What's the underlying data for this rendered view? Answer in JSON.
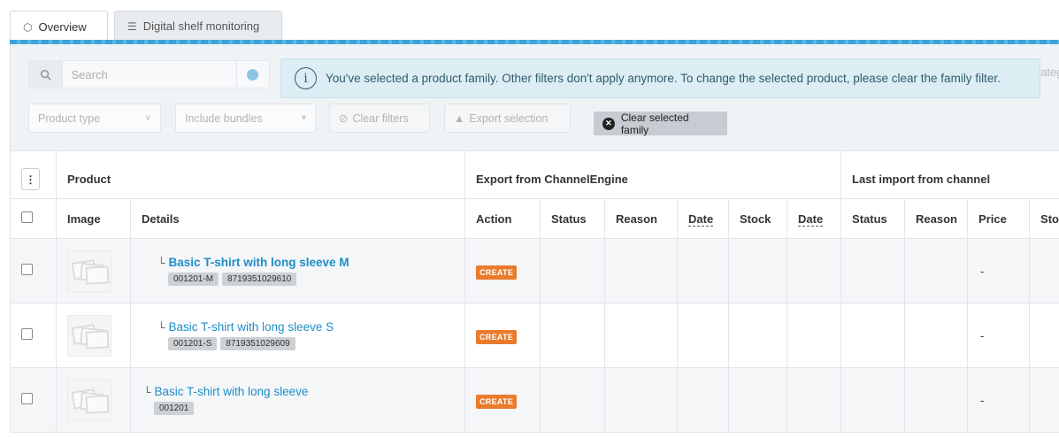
{
  "tabs": [
    {
      "label": "Overview",
      "icon": "tag-icon",
      "active": true
    },
    {
      "label": "Digital shelf monitoring",
      "icon": "list-icon",
      "active": false
    }
  ],
  "filters": {
    "search_placeholder": "Search",
    "alert_text": "You've selected a product family. Other filters don't apply anymore. To change the selected product, please clear the family filter.",
    "alert_tail": "ateg",
    "product_type": "Product type",
    "bundles": "Include bundles",
    "clear_filters": "Clear filters",
    "export_selection": "Export selection",
    "clear_family": "Clear selected family"
  },
  "table": {
    "group_headers": {
      "product": "Product",
      "export": "Export from ChannelEngine",
      "import": "Last import from channel"
    },
    "columns": {
      "image": "Image",
      "details": "Details",
      "action": "Action",
      "status": "Status",
      "reason": "Reason",
      "date": "Date",
      "stock": "Stock",
      "date2": "Date",
      "status2": "Status",
      "reason2": "Reason",
      "price": "Price",
      "stock2": "Sto"
    },
    "rows": [
      {
        "name": "Basic T-shirt with long sleeve M",
        "sku": "001201-M",
        "ean": "8719351029610",
        "action": "CREATE",
        "price": "-"
      },
      {
        "name": "Basic T-shirt with long sleeve S",
        "sku": "001201-S",
        "ean": "8719351029609",
        "action": "CREATE",
        "price": "-"
      },
      {
        "name": "Basic T-shirt with long sleeve",
        "sku": "001201",
        "action": "CREATE",
        "price": "-"
      }
    ]
  }
}
